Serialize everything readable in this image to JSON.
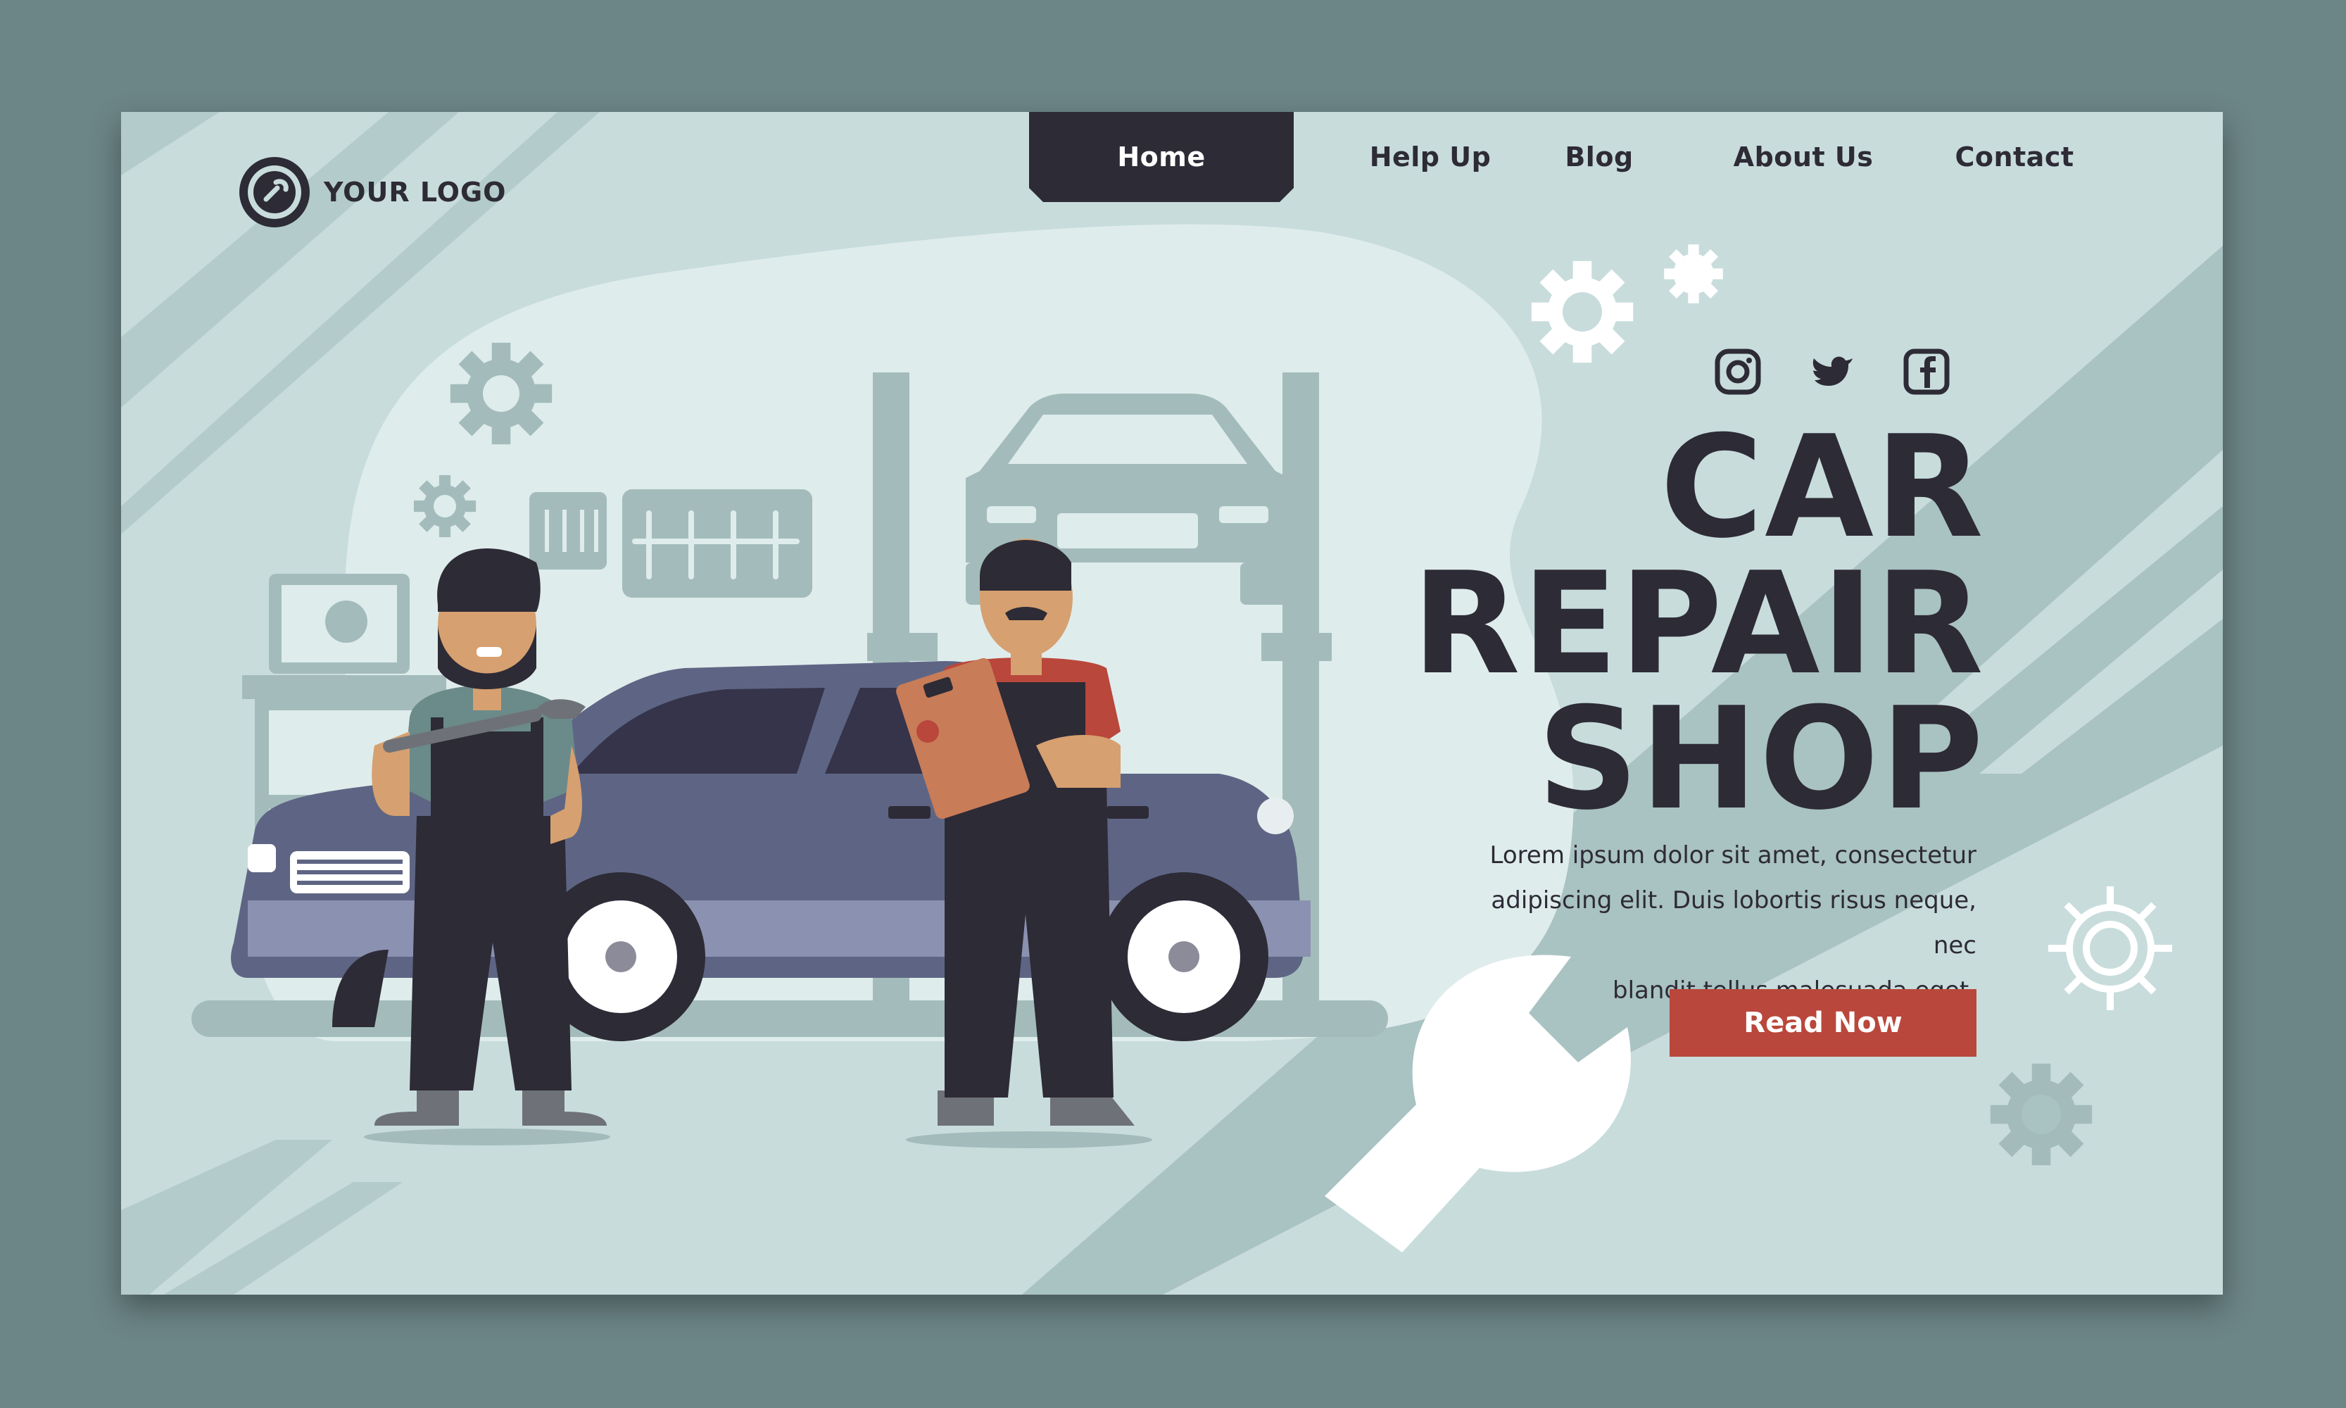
{
  "logo": {
    "text": "YOUR LOGO",
    "icon": "gear-wrench-logo-icon"
  },
  "nav": {
    "items": [
      {
        "label": "Home",
        "active": true
      },
      {
        "label": "Help Up",
        "active": false
      },
      {
        "label": "Blog",
        "active": false
      },
      {
        "label": "About Us",
        "active": false
      },
      {
        "label": "Contact",
        "active": false
      }
    ]
  },
  "social": [
    "instagram-icon",
    "twitter-icon",
    "facebook-icon"
  ],
  "hero": {
    "title_lines": [
      "CAR",
      "REPAIR",
      "SHOP"
    ],
    "description_lines": [
      "Lorem ipsum dolor sit amet, consectetur",
      "adipiscing elit. Duis lobortis risus neque, nec",
      "blandit tellus malesuada eget."
    ],
    "cta": "Read Now"
  },
  "colors": {
    "background": "#c8dcdc",
    "frame": "#6c8587",
    "dark": "#2d2b36",
    "accent": "#b9473b",
    "car": "#5e6584",
    "muted": "#a3bcbb"
  }
}
